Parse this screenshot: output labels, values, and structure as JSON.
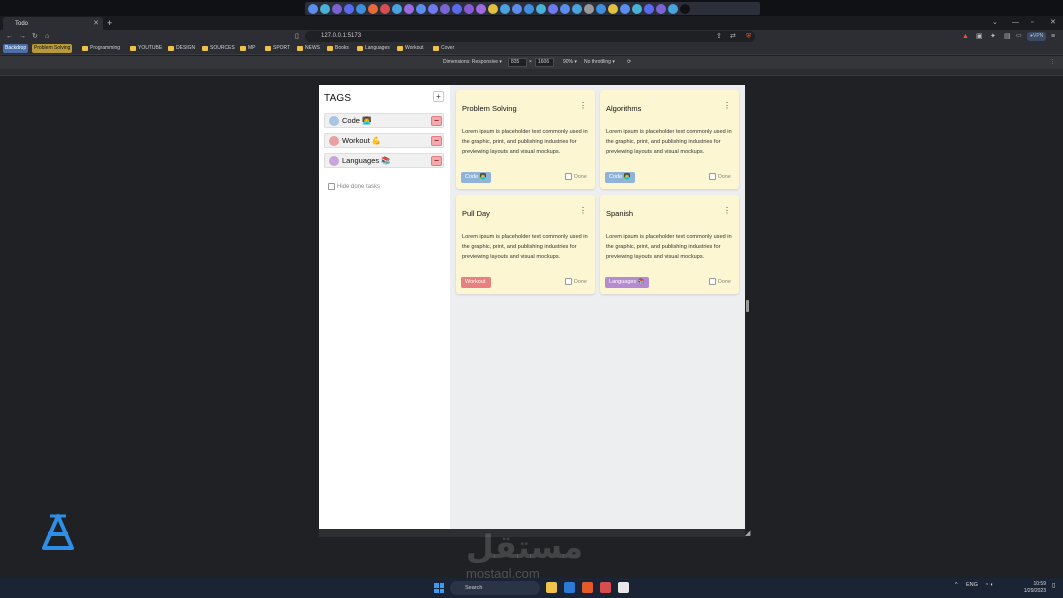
{
  "browser": {
    "tab_title": "Todo",
    "url": "127.0.0.1:5173",
    "bookmarks": [
      "Programming",
      "YOUTUBE",
      "DESIGN",
      "SOURCES",
      "MP",
      "SPORT",
      "NEWS",
      "Books",
      "Languages",
      "Workout",
      "Cover"
    ],
    "bookmark_chips": [
      "Backdrop",
      "Problem Solving"
    ],
    "devtools": {
      "dimensions_label": "Dimensions: Responsive",
      "width": "835",
      "times": "×",
      "height": "1606",
      "zoom": "90%",
      "throttle": "No throttling"
    }
  },
  "app": {
    "sidebar": {
      "title": "TAGS",
      "add_label": "+",
      "remove_label": "−",
      "tags": [
        {
          "label": "Code",
          "emoji": "👨‍💻",
          "color": "#a9c4e4"
        },
        {
          "label": "Workout",
          "emoji": "💪",
          "color": "#e8a0a0"
        },
        {
          "label": "Languages",
          "emoji": "📚",
          "color": "#c7a6dc"
        }
      ],
      "hide_done_label": "Hide done tasks"
    },
    "cards": [
      {
        "title": "Problem Solving",
        "body": "Lorem ipsum is placeholder text commonly used in the graphic, print, and publishing industries for previewing layouts and visual mockups.",
        "tag": "Code 👨‍💻",
        "tag_color": "#8fb3d9",
        "done_label": "Done",
        "menu": "⋮"
      },
      {
        "title": "Algorithms",
        "body": "Lorem ipsum is placeholder text commonly used in the graphic, print, and publishing industries for previewing layouts and visual mockups.",
        "tag": "Code 👨‍💻",
        "tag_color": "#8fb3d9",
        "done_label": "Done",
        "menu": "⋮"
      },
      {
        "title": "Pull Day",
        "body": "Lorem ipsum is placeholder text commonly used in the graphic, print, and publishing industries for previewing layouts and visual mockups.",
        "tag": "Workout",
        "tag_color": "#e8807f",
        "done_label": "Done",
        "menu": "⋮"
      },
      {
        "title": "Spanish",
        "body": "Lorem ipsum is placeholder text commonly used in the graphic, print, and publishing industries for previewing layouts and visual mockups.",
        "tag": "Languages 📚",
        "tag_color": "#b48ad0",
        "done_label": "Done",
        "menu": "⋮"
      }
    ]
  },
  "watermark": {
    "arabic": "مستقل",
    "latin": "mostaql.com"
  },
  "taskbar": {
    "search_placeholder": "Search",
    "tray_lang": "ENG",
    "time": "10:59",
    "date": "1/29/2023"
  },
  "colors": {
    "accent_blue": "#3d9cf0",
    "folder": "#f0c24a"
  }
}
